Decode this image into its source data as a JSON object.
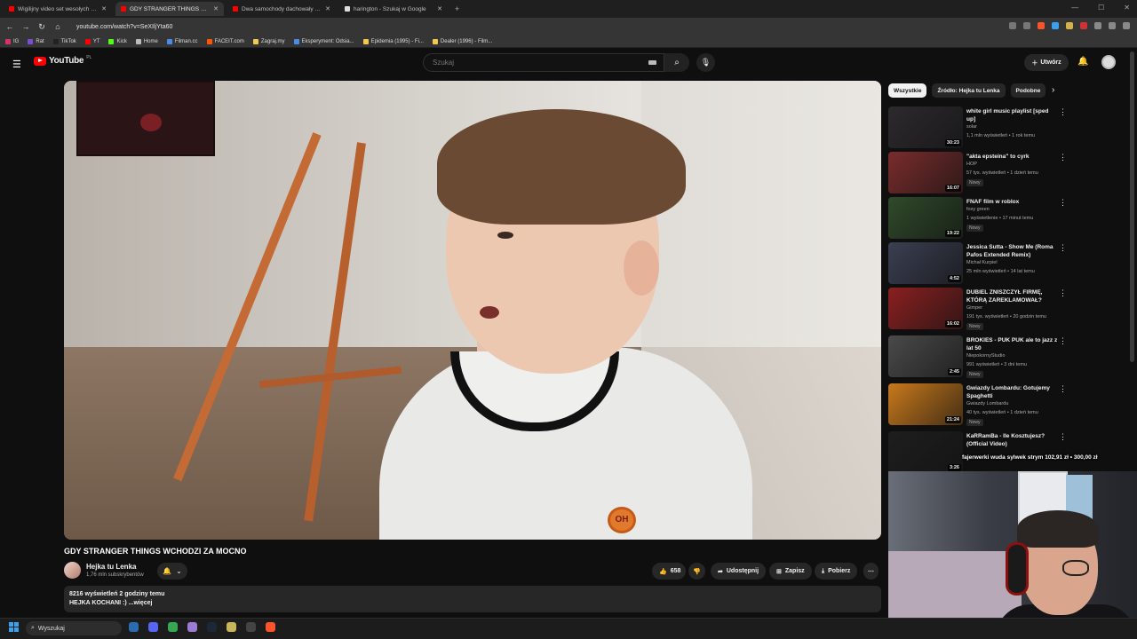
{
  "browser": {
    "tabs": [
      {
        "title": "Wigilijny video set wesołych świąt ko",
        "favicon_color": "#ff0000",
        "active": false
      },
      {
        "title": "GDY STRANGER THINGS WCHODZI ZA MOCNO",
        "favicon_color": "#ff0000",
        "active": true
      },
      {
        "title": "Dwa samochody dachowały po niesu",
        "favicon_color": "#ff0000",
        "active": false
      },
      {
        "title": "harington - Szukaj w Google",
        "favicon_color": "#dddddd",
        "active": false
      }
    ],
    "new_tab": "+",
    "url": "youtube.com/watch?v=SeXIljYta60",
    "bookmarks": [
      {
        "label": "IG",
        "color": "#d6336c"
      },
      {
        "label": "Rat",
        "color": "#7b4dd6"
      },
      {
        "label": "TikTok",
        "color": "#222222"
      },
      {
        "label": "YT",
        "color": "#ff0000"
      },
      {
        "label": "Kick",
        "color": "#53fc18"
      },
      {
        "label": "Home",
        "color": "#bbbbbb"
      },
      {
        "label": "Filman.cc",
        "color": "#4b8be8"
      },
      {
        "label": "FACEIT.com",
        "color": "#ff5500"
      },
      {
        "label": "Zagraj.my",
        "color": "#f2c94c"
      },
      {
        "label": "Eksperyment: Odsia...",
        "color": "#4b8be8"
      },
      {
        "label": "Epidemia (1995) - Fi...",
        "color": "#f2c94c"
      },
      {
        "label": "Dealer (1996) - Film...",
        "color": "#f2c94c"
      }
    ]
  },
  "youtube": {
    "logo_text": "YouTube",
    "logo_region": "PL",
    "search_placeholder": "Szukaj",
    "create_label": "Utwórz",
    "video": {
      "title": "GDY STRANGER THINGS WCHODZI ZA MOCNO",
      "badge_text": "OH"
    },
    "channel": {
      "name": "Hejka tu Lenka",
      "subs": "1,76 mln subskrybentów"
    },
    "actions": {
      "likes": "658",
      "share": "Udostępnij",
      "save": "Zapisz",
      "download": "Pobierz"
    },
    "description": {
      "meta": "8216 wyświetleń  2 godziny temu",
      "text": "HEJKA KOCHANI :) ...więcej"
    },
    "chips": [
      "Wszystkie",
      "Źródło: Hejka tu Lenka",
      "Podobne"
    ],
    "recommendations": [
      {
        "title": "white girl music playlist [sped up]",
        "channel": "solar",
        "meta": "1,1 mln wyświetleń • 1 rok temu",
        "duration": "30:23",
        "new": "",
        "thumb": "#2d2a2e"
      },
      {
        "title": "\"akta epsteina\" to cyrk",
        "channel": "HOP",
        "meta": "57 tys. wyświetleń • 1 dzień temu",
        "duration": "16:07",
        "new": "Nowy",
        "thumb": "#7a2c2c"
      },
      {
        "title": "FNAF film w roblox",
        "channel": "foxy green",
        "meta": "1 wyświetlenie • 17 minut temu",
        "duration": "19:22",
        "new": "Nowy",
        "thumb": "#2f4a2a"
      },
      {
        "title": "Jessica Sutta - Show Me (Roma Pafos Extended Remix)",
        "channel": "Michał Kurpiel",
        "meta": "25 mln wyświetleń • 14 lat temu",
        "duration": "4:52",
        "new": "",
        "thumb": "#3b3f52"
      },
      {
        "title": "DUBIEL ZNISZCZYŁ FIRMĘ, KTÓRĄ ZAREKLAMOWAŁ?",
        "channel": "Gimper",
        "meta": "191 tys. wyświetleń • 20 godzin temu",
        "duration": "16:02",
        "new": "Nowy",
        "thumb": "#8a2020"
      },
      {
        "title": "BROKIES - PUK PUK ale to jazz z lat 50",
        "channel": "NiepokornyStudio",
        "meta": "991 wyświetleń • 3 dni temu",
        "duration": "2:45",
        "new": "Nowy",
        "thumb": "#4a4a4a"
      },
      {
        "title": "Gwiazdy Lombardu: Gotujemy Spaghetti",
        "channel": "Gwiazdy Lombardu",
        "meta": "40 tys. wyświetleń • 1 dzień temu",
        "duration": "21:24",
        "new": "Nowy",
        "thumb": "#c8791c"
      },
      {
        "title": "KaRRamBa - Ile Kosztujesz? (Official Video)",
        "channel": "",
        "meta": "",
        "duration": "3:26",
        "new": "",
        "thumb": "#1e1e1e"
      }
    ],
    "dur_icon": "♪"
  },
  "overlay": {
    "donation": "fajerwerki wuda sylwek strym  102,91 zł   •  300,00 zł"
  },
  "taskbar": {
    "search_label": "Wyszukaj",
    "apps": [
      {
        "name": "explorer",
        "color": "#2b6cb0"
      },
      {
        "name": "discord",
        "color": "#5865f2"
      },
      {
        "name": "chrome",
        "color": "#34a853"
      },
      {
        "name": "feather",
        "color": "#9b7bd6"
      },
      {
        "name": "steam",
        "color": "#1b2838"
      },
      {
        "name": "leaf",
        "color": "#c9b458"
      },
      {
        "name": "obs",
        "color": "#444444"
      },
      {
        "name": "brave",
        "color": "#fb542b"
      }
    ]
  },
  "colors": {
    "accent": "#ff0000",
    "background": "#0f0f0f",
    "surface": "#272727"
  }
}
